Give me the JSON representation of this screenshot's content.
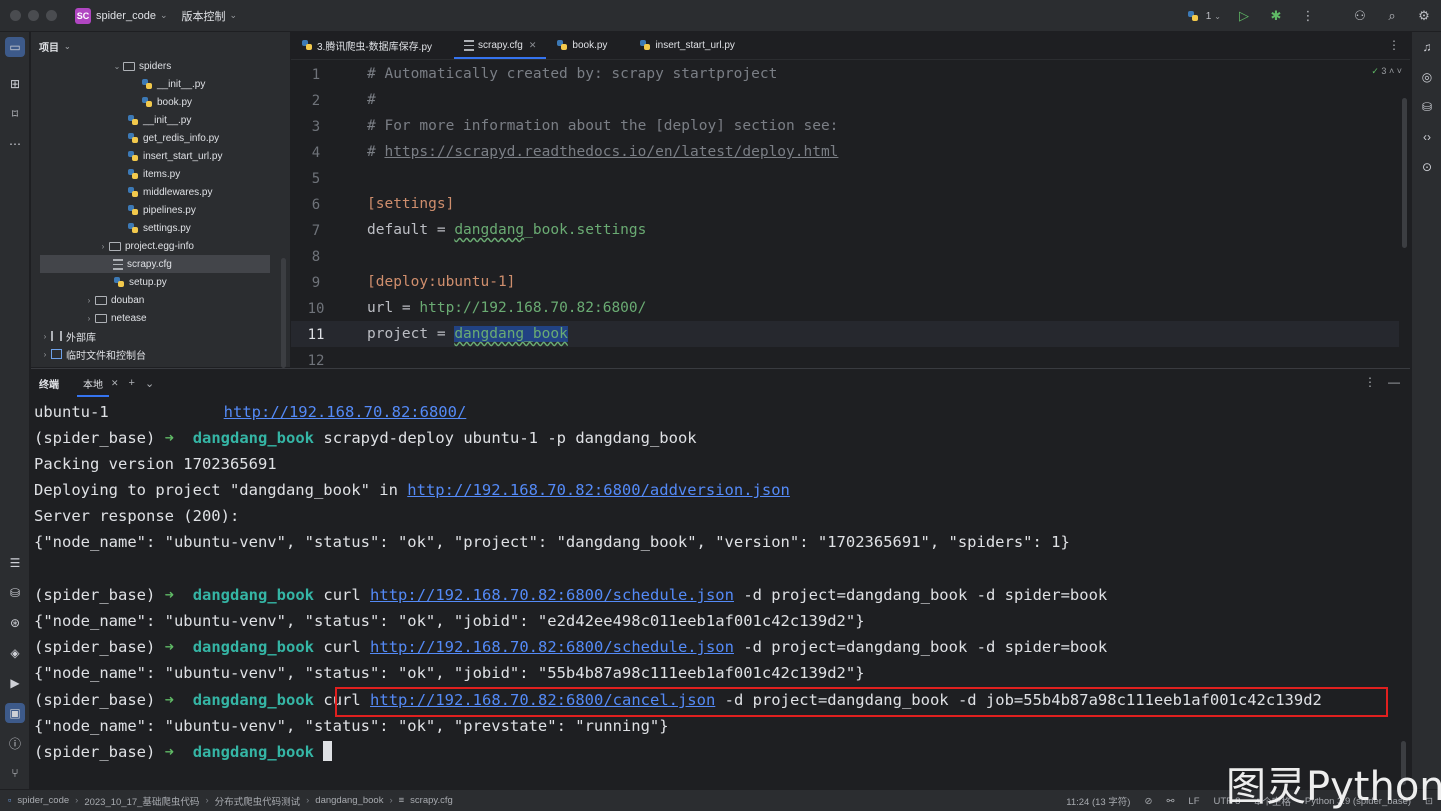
{
  "titlebar": {
    "project_badge": "SC",
    "project_name": "spider_code",
    "vcs_label": "版本控制",
    "run_config": "1"
  },
  "project_panel": {
    "title": "项目",
    "tree": [
      {
        "label": "spiders",
        "type": "folder",
        "expanded": true
      },
      {
        "label": "__init__.py",
        "type": "py"
      },
      {
        "label": "book.py",
        "type": "py"
      },
      {
        "label": "__init__.py",
        "type": "py"
      },
      {
        "label": "get_redis_info.py",
        "type": "py"
      },
      {
        "label": "insert_start_url.py",
        "type": "py"
      },
      {
        "label": "items.py",
        "type": "py"
      },
      {
        "label": "middlewares.py",
        "type": "py"
      },
      {
        "label": "pipelines.py",
        "type": "py"
      },
      {
        "label": "settings.py",
        "type": "py"
      },
      {
        "label": "project.egg-info",
        "type": "folder",
        "expanded": false
      },
      {
        "label": "scrapy.cfg",
        "type": "cfg",
        "selected": true
      },
      {
        "label": "setup.py",
        "type": "py"
      },
      {
        "label": "douban",
        "type": "folder",
        "expanded": false
      },
      {
        "label": "netease",
        "type": "folder",
        "expanded": false
      },
      {
        "label": "外部库",
        "type": "lib",
        "expanded": false
      },
      {
        "label": "临时文件和控制台",
        "type": "scratch",
        "expanded": false
      }
    ]
  },
  "editor": {
    "tabs": [
      {
        "label": "3.腾讯爬虫-数据库保存.py",
        "icon": "python-file-icon"
      },
      {
        "label": "scrapy.cfg",
        "icon": "config-file-icon",
        "active": true
      },
      {
        "label": "book.py",
        "icon": "python-file-icon"
      },
      {
        "label": "insert_start_url.py",
        "icon": "python-file-icon"
      }
    ],
    "inspection_count": "3",
    "line_numbers": [
      "1",
      "2",
      "3",
      "4",
      "5",
      "6",
      "7",
      "8",
      "9",
      "10",
      "11",
      "12"
    ],
    "lines": {
      "l1": "# Automatically created by: scrapy startproject",
      "l2": "#",
      "l3": "# For more information about the [deploy] section see:",
      "l4_prefix": "# ",
      "l4_link": "https://scrapyd.readthedocs.io/en/latest/deploy.html",
      "l6": "[settings]",
      "l7_key": "default = ",
      "l7_pkg": "dangdang",
      "l7_rest": "_book.settings",
      "l9": "[deploy:ubuntu-1]",
      "l10_key": "url = ",
      "l10_val": "http://192.168.70.82:6800/",
      "l11_key": "project = ",
      "l11_val": "dangdang_book"
    }
  },
  "terminal": {
    "title": "终端",
    "tab_label": "本地",
    "prompt_env": "(spider_base)",
    "prompt_arrow": "➜",
    "prompt_dir": "dangdang_book",
    "lines": {
      "t1_name": "ubuntu-1",
      "t1_url": "http://192.168.70.82:6800/",
      "t2_cmd": "scrapyd-deploy ubuntu-1 -p dangdang_book",
      "t3": "Packing version 1702365691",
      "t4_text": "Deploying to project \"dangdang_book\" in ",
      "t4_url": "http://192.168.70.82:6800/addversion.json",
      "t5": "Server response (200):",
      "t6": "{\"node_name\": \"ubuntu-venv\", \"status\": \"ok\", \"project\": \"dangdang_book\", \"version\": \"1702365691\", \"spiders\": 1}",
      "t8_pre": "curl ",
      "t8_url": "http://192.168.70.82:6800/schedule.json",
      "t8_post": " -d project=dangdang_book -d spider=book",
      "t9": "{\"node_name\": \"ubuntu-venv\", \"status\": \"ok\", \"jobid\": \"e2d42ee498c011eeb1af001c42c139d2\"}",
      "t10_pre": "curl ",
      "t10_url": "http://192.168.70.82:6800/schedule.json",
      "t10_post": " -d project=dangdang_book -d spider=book",
      "t11": "{\"node_name\": \"ubuntu-venv\", \"status\": \"ok\", \"jobid\": \"55b4b87a98c111eeb1af001c42c139d2\"}",
      "t12_pre": "curl ",
      "t12_url": "http://192.168.70.82:6800/cancel.json",
      "t12_post": " -d project=dangdang_book -d job=55b4b87a98c111eeb1af001c42c139d2",
      "t13": "{\"node_name\": \"ubuntu-venv\", \"status\": \"ok\", \"prevstate\": \"running\"}"
    }
  },
  "statusbar": {
    "breadcrumbs": [
      "spider_code",
      "2023_10_17_基础爬虫代码",
      "分布式爬虫代码测试",
      "dangdang_book",
      "scrapy.cfg"
    ],
    "position": "11:24 (13 字符)",
    "line_ending": "LF",
    "encoding": "UTF-8",
    "indent": "4 个空格",
    "interpreter": "Python 3.9 (spider_base)"
  },
  "watermark": "图灵Python",
  "colors": {
    "accent": "#3574f0",
    "terminal_prompt_arrow": "#5fb865",
    "terminal_dir": "#35b5a5",
    "link": "#548af7",
    "highlight_box": "#e0201f"
  }
}
